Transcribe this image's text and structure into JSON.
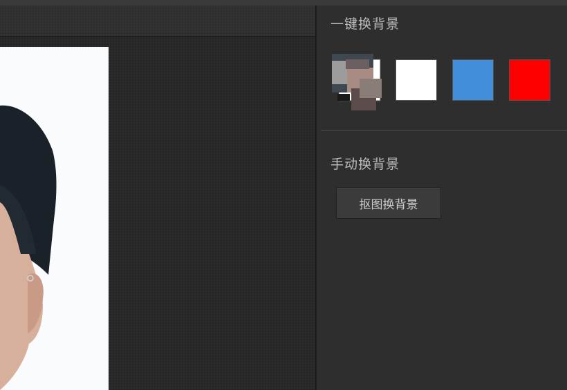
{
  "panel": {
    "auto_section_title": "一键换背景",
    "manual_section_title": "手动换背景",
    "cutout_button_label": "抠图换背景"
  },
  "swatches": [
    {
      "name": "original",
      "icon": "original-photo-thumbnail"
    },
    {
      "name": "white",
      "color": "#ffffff"
    },
    {
      "name": "blue",
      "color": "#438edb"
    },
    {
      "name": "red",
      "color": "#ff0000"
    }
  ],
  "colors": {
    "panel_bg": "#2e2e2e",
    "canvas_bg": "#262626",
    "photo_bg": "#f9fbfc"
  }
}
